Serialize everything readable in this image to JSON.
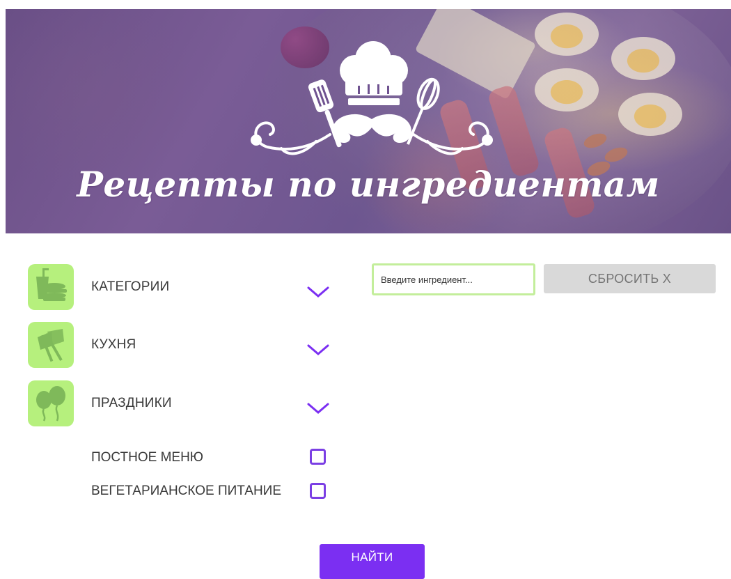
{
  "banner": {
    "title": "Рецепты по ингредиентам",
    "logo_icon": "chef-hat-mustache-logo"
  },
  "filters": [
    {
      "label": "КАТЕГОРИИ",
      "icon": "fast-food-icon"
    },
    {
      "label": "КУХНЯ",
      "icon": "flags-icon"
    },
    {
      "label": "ПРАЗДНИКИ",
      "icon": "balloons-icon"
    }
  ],
  "checks": [
    {
      "label": "ПОСТНОЕ МЕНЮ",
      "checked": false
    },
    {
      "label": "ВЕГЕТАРИАНСКОЕ ПИТАНИЕ",
      "checked": false
    }
  ],
  "search": {
    "placeholder": "Введите ингредиент...",
    "value": "",
    "reset_label": "СБРОСИТЬ X"
  },
  "actions": {
    "find_label": "НАЙТИ"
  },
  "colors": {
    "accent": "#7b2ff2",
    "checkbox_border": "#7b3fe4",
    "icon_bg": "#b6f07d",
    "icon_fg": "#7fb95a",
    "input_border": "#c3ee9b",
    "reset_bg": "#d9d9d9",
    "banner_overlay": "#6f5290"
  }
}
